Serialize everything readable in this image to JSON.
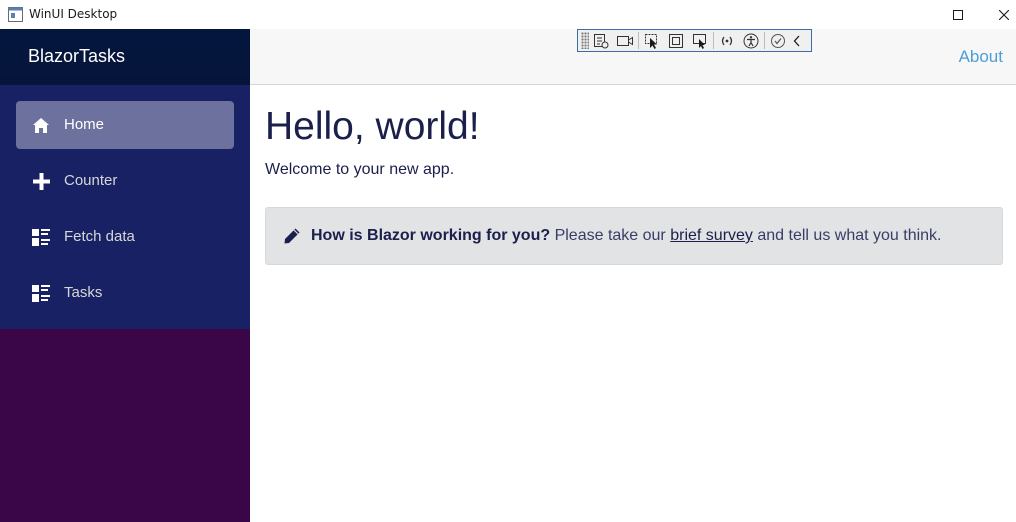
{
  "window": {
    "title": "WinUI Desktop"
  },
  "sidebar": {
    "brand": "BlazorTasks",
    "items": [
      {
        "label": "Home",
        "icon": "home-icon",
        "active": true
      },
      {
        "label": "Counter",
        "icon": "plus-icon",
        "active": false
      },
      {
        "label": "Fetch data",
        "icon": "list-rich-icon",
        "active": false
      },
      {
        "label": "Tasks",
        "icon": "list-rich-icon",
        "active": false
      }
    ]
  },
  "top_row": {
    "about": "About"
  },
  "main": {
    "title": "Hello, world!",
    "welcome": "Welcome to your new app.",
    "survey": {
      "strong": "How is Blazor working for you?",
      "before_link": "Please take our",
      "link": "brief survey",
      "after_link": "and tell us what you think."
    }
  },
  "colors": {
    "sidebar_top": "#052767",
    "sidebar_bottom": "#3a0647",
    "link": "#4c9ed6",
    "text_dark": "#1b1f4b",
    "survey_bg": "#e2e3e5"
  }
}
